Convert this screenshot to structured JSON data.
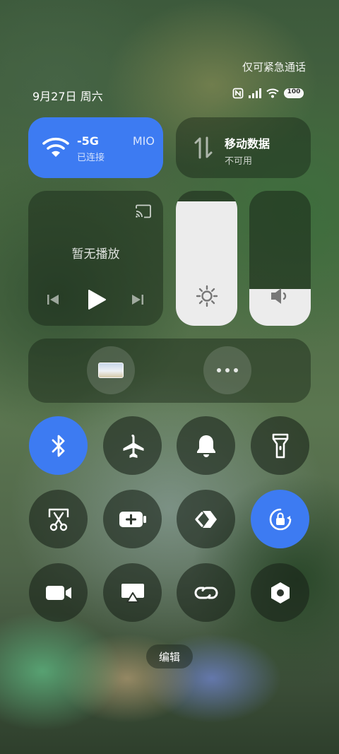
{
  "status_bar": {
    "emergency_text": "仅可紧急通话",
    "date_text": "9月27日 周六",
    "battery_level": "100"
  },
  "wifi_tile": {
    "title": "-5G",
    "title_suffix": "MIO",
    "subtitle": "已连接",
    "active": true
  },
  "mobile_tile": {
    "title": "移动数据",
    "subtitle": "不可用",
    "active": false
  },
  "media": {
    "status_text": "暂无播放"
  },
  "sliders": {
    "brightness_level": 0.92,
    "volume_level": 0.27
  },
  "toggles": [
    {
      "name": "bluetooth",
      "on": true
    },
    {
      "name": "airplane",
      "on": false
    },
    {
      "name": "ringer",
      "on": false
    },
    {
      "name": "flashlight",
      "on": false
    },
    {
      "name": "screenshot",
      "on": false
    },
    {
      "name": "battery-saver",
      "on": false
    },
    {
      "name": "cast",
      "on": false
    },
    {
      "name": "rotation-lock",
      "on": true
    },
    {
      "name": "screen-record",
      "on": false
    },
    {
      "name": "screen-mirror",
      "on": false
    },
    {
      "name": "link",
      "on": false
    },
    {
      "name": "settings",
      "on": false
    }
  ],
  "edit_label": "编辑",
  "colors": {
    "accent": "#3d7bf2"
  }
}
